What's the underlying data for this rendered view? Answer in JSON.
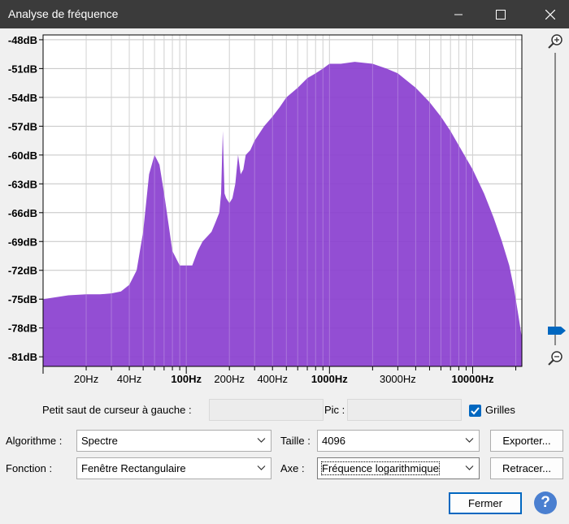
{
  "window": {
    "title": "Analyse de fréquence"
  },
  "chart_data": {
    "type": "area",
    "color": "#8a3fcf",
    "xscale": "log",
    "xlim": [
      10,
      22050
    ],
    "ylim": [
      -82,
      -47.5
    ],
    "y_ticks": [
      -48,
      -51,
      -54,
      -57,
      -60,
      -63,
      -66,
      -69,
      -72,
      -75,
      -78,
      -81
    ],
    "y_tick_labels": [
      "-48dB",
      "-51dB",
      "-54dB",
      "-57dB",
      "-60dB",
      "-63dB",
      "-66dB",
      "-69dB",
      "-72dB",
      "-75dB",
      "-78dB",
      "-81dB"
    ],
    "x_ticks": [
      20,
      40,
      100,
      200,
      400,
      1000,
      3000,
      10000
    ],
    "x_tick_labels": [
      "20Hz",
      "40Hz",
      "100Hz",
      "200Hz",
      "400Hz",
      "1000Hz",
      "3000Hz",
      "10000Hz"
    ],
    "x_bold": [
      false,
      false,
      true,
      false,
      false,
      true,
      false,
      true
    ],
    "grid": true,
    "x": [
      10,
      15,
      20,
      25,
      30,
      35,
      40,
      45,
      50,
      55,
      60,
      65,
      70,
      80,
      90,
      100,
      110,
      120,
      130,
      150,
      160,
      170,
      175,
      180,
      185,
      190,
      200,
      210,
      220,
      230,
      240,
      250,
      260,
      280,
      300,
      350,
      400,
      450,
      500,
      600,
      700,
      800,
      900,
      1000,
      1200,
      1500,
      2000,
      2500,
      3000,
      4000,
      5000,
      6000,
      7000,
      8000,
      10000,
      12000,
      14000,
      16000,
      18000,
      19500,
      21000,
      22050
    ],
    "y": [
      -75,
      -74.6,
      -74.5,
      -74.5,
      -74.4,
      -74.2,
      -73.5,
      -72,
      -68,
      -62,
      -60,
      -61,
      -64,
      -70,
      -71.5,
      -71.5,
      -71.5,
      -70,
      -69,
      -68,
      -67,
      -66,
      -64,
      -57.5,
      -64,
      -64.5,
      -65,
      -64.5,
      -63,
      -60,
      -62,
      -61.5,
      -60,
      -59.5,
      -58.5,
      -57,
      -56,
      -55,
      -54,
      -53,
      -52,
      -51.5,
      -51,
      -50.5,
      -50.5,
      -50.3,
      -50.5,
      -51,
      -51.5,
      -53,
      -54.5,
      -56,
      -57.5,
      -59,
      -61.5,
      -64,
      -66.5,
      -69,
      -71.5,
      -74,
      -77,
      -79
    ]
  },
  "zoom": {
    "level": 0.05
  },
  "controls": {
    "cursor_label": "Petit saut de curseur à gauche :",
    "cursor_value": "",
    "peak_label": "Pic :",
    "peak_value": "",
    "grids_label": "Grilles",
    "grids_checked": true,
    "algorithm_label": "Algorithme :",
    "algorithm_value": "Spectre",
    "size_label": "Taille :",
    "size_value": "4096",
    "export_label": "Exporter...",
    "function_label": "Fonction :",
    "function_value": "Fenêtre Rectangulaire",
    "axis_label": "Axe :",
    "axis_value": "Fréquence logarithmique",
    "replot_label": "Retracer...",
    "close_label": "Fermer",
    "help_label": "?"
  }
}
